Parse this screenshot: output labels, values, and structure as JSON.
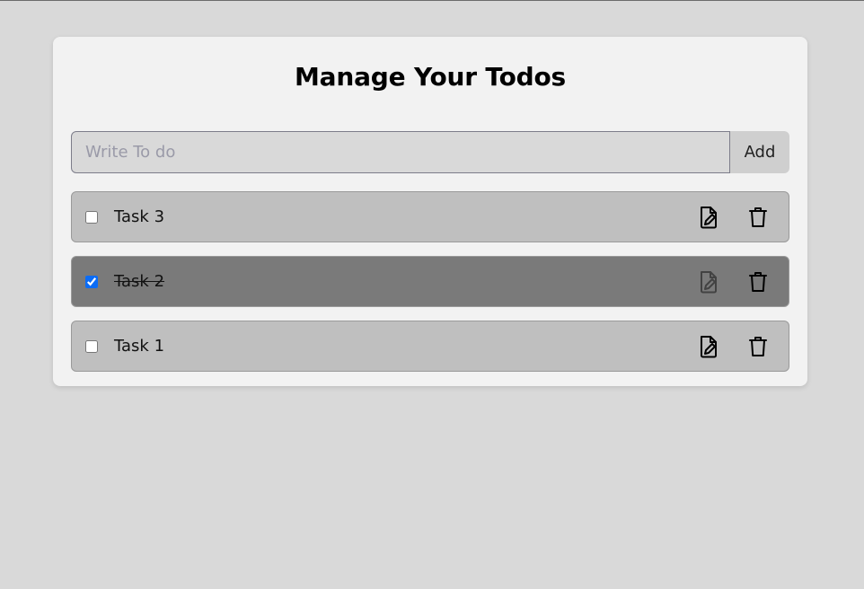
{
  "header": {
    "title": "Manage Your Todos"
  },
  "form": {
    "placeholder": "Write To do",
    "value": "",
    "add_label": "Add"
  },
  "todos": [
    {
      "text": "Task 3",
      "completed": false,
      "edit_icon": "edit-file-icon",
      "delete_icon": "trash-icon"
    },
    {
      "text": "Task 2",
      "completed": true,
      "edit_icon": "edit-file-icon",
      "delete_icon": "trash-icon"
    },
    {
      "text": "Task 1",
      "completed": false,
      "edit_icon": "edit-file-icon",
      "delete_icon": "trash-icon"
    }
  ],
  "colors": {
    "page_bg": "#d9d9d9",
    "card_bg": "#f2f2f2",
    "item_bg": "#bfbfbf",
    "item_done_bg": "#7a7a7a",
    "checkbox_accent": "#0b6cf5"
  }
}
